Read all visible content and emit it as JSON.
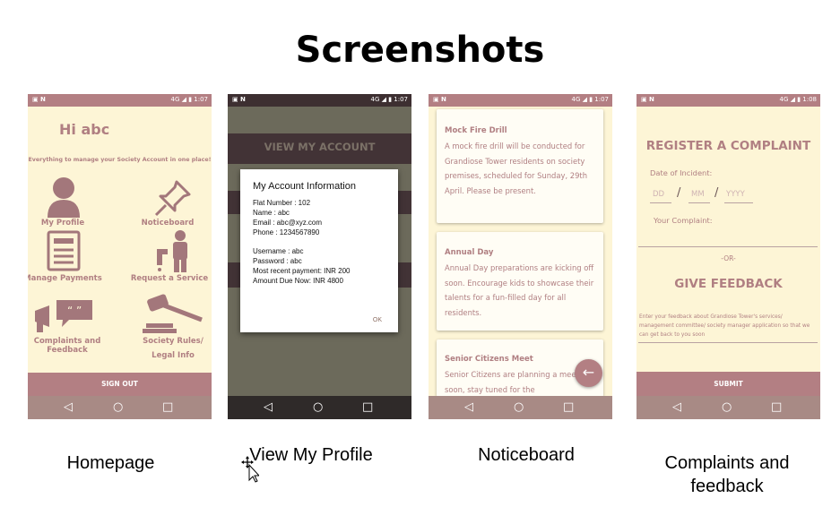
{
  "slide": {
    "title": "Screenshots"
  },
  "status": {
    "left_icons": "▣  N",
    "right_1": "4G ◢ ▮ 1:07",
    "right_2": "4G ◢ ▮ 1:08"
  },
  "nav": {
    "back": "◁",
    "home": "○",
    "recent": "□"
  },
  "home": {
    "greeting": "Hi abc",
    "subtitle": "Everything to manage your Society Account in one place!",
    "tiles": [
      "My Profile",
      "Noticeboard",
      "Manage Payments",
      "Request a Service",
      "Complaints and Feedback",
      "Society Rules/",
      "Legal Info"
    ],
    "signout": "SIGN OUT"
  },
  "profile": {
    "header": "VIEW MY ACCOUNT",
    "dialog_title": "My  Account Information",
    "lines": [
      "Flat Number :  102",
      "Name :  abc",
      "Email :  abc@xyz.com",
      "Phone :  1234567890",
      "Username :  abc",
      "Password :  abc",
      "Most recent payment: INR 200",
      "Amount Due Now: INR 4800"
    ],
    "ok": "OK"
  },
  "noticeboard": {
    "cards": [
      {
        "title": "Mock Fire Drill",
        "body": "A mock fire drill will be conducted for Grandiose Tower residents on society premises, scheduled for Sunday, 29th April. Please be present."
      },
      {
        "title": "Annual Day",
        "body": "Annual Day preparations are kicking off soon. Encourage kids to showcase their talents for a fun-filled day for all residents."
      },
      {
        "title": "Senior Citizens Meet",
        "body": "Senior Citizens are planning a meeting soon, stay tuned for the"
      }
    ],
    "fab_icon": "←"
  },
  "complaint": {
    "title": "REGISTER A COMPLAINT",
    "date_label": "Date of Incident:",
    "dd": "DD",
    "mm": "MM",
    "yyyy": "YYYY",
    "sep": "/",
    "complaint_label": "Your Complaint:",
    "or": "-OR-",
    "feedback_title": "GIVE FEEDBACK",
    "feedback_placeholder": "Enter your feedback about Grandiose Tower's services/ management committee/ society manager application so that we can get back to you soon",
    "submit": "SUBMIT"
  },
  "captions": [
    "Homepage",
    "View My Profile",
    "Noticeboard",
    "Complaints and",
    "feedback"
  ],
  "colors": {
    "accent": "#b37f83",
    "bg": "#fdf5d6",
    "nav": "#a88a85",
    "text": "#b07f82"
  }
}
